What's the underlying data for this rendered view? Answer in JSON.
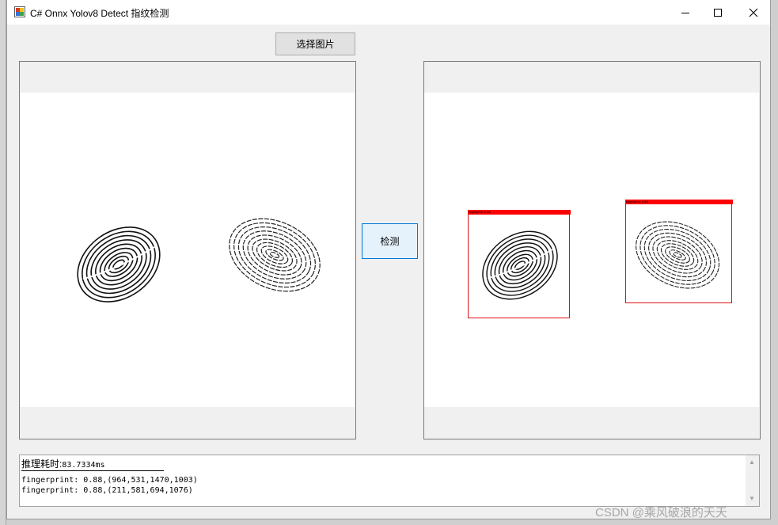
{
  "window": {
    "title": "C# Onnx Yolov8 Detect 指纹检测",
    "controls": [
      "minimize",
      "maximize",
      "close"
    ],
    "icon": "app-icon"
  },
  "buttons": {
    "select_image": "选择图片",
    "detect": "检测"
  },
  "left_panel": {
    "image": "input fingerprint image",
    "fingerprints": 2
  },
  "right_panel": {
    "detections": [
      {
        "label": "fingerprint: 0.88"
      },
      {
        "label": "fingerprint: 0.88"
      }
    ]
  },
  "output": {
    "time_label": "推理耗时:",
    "time_value": "83.7334ms",
    "results": [
      "fingerprint: 0.88,(964,531,1470,1003)",
      "fingerprint: 0.88,(211,581,694,1076)"
    ]
  },
  "watermark": "CSDN @乘风破浪的天天"
}
